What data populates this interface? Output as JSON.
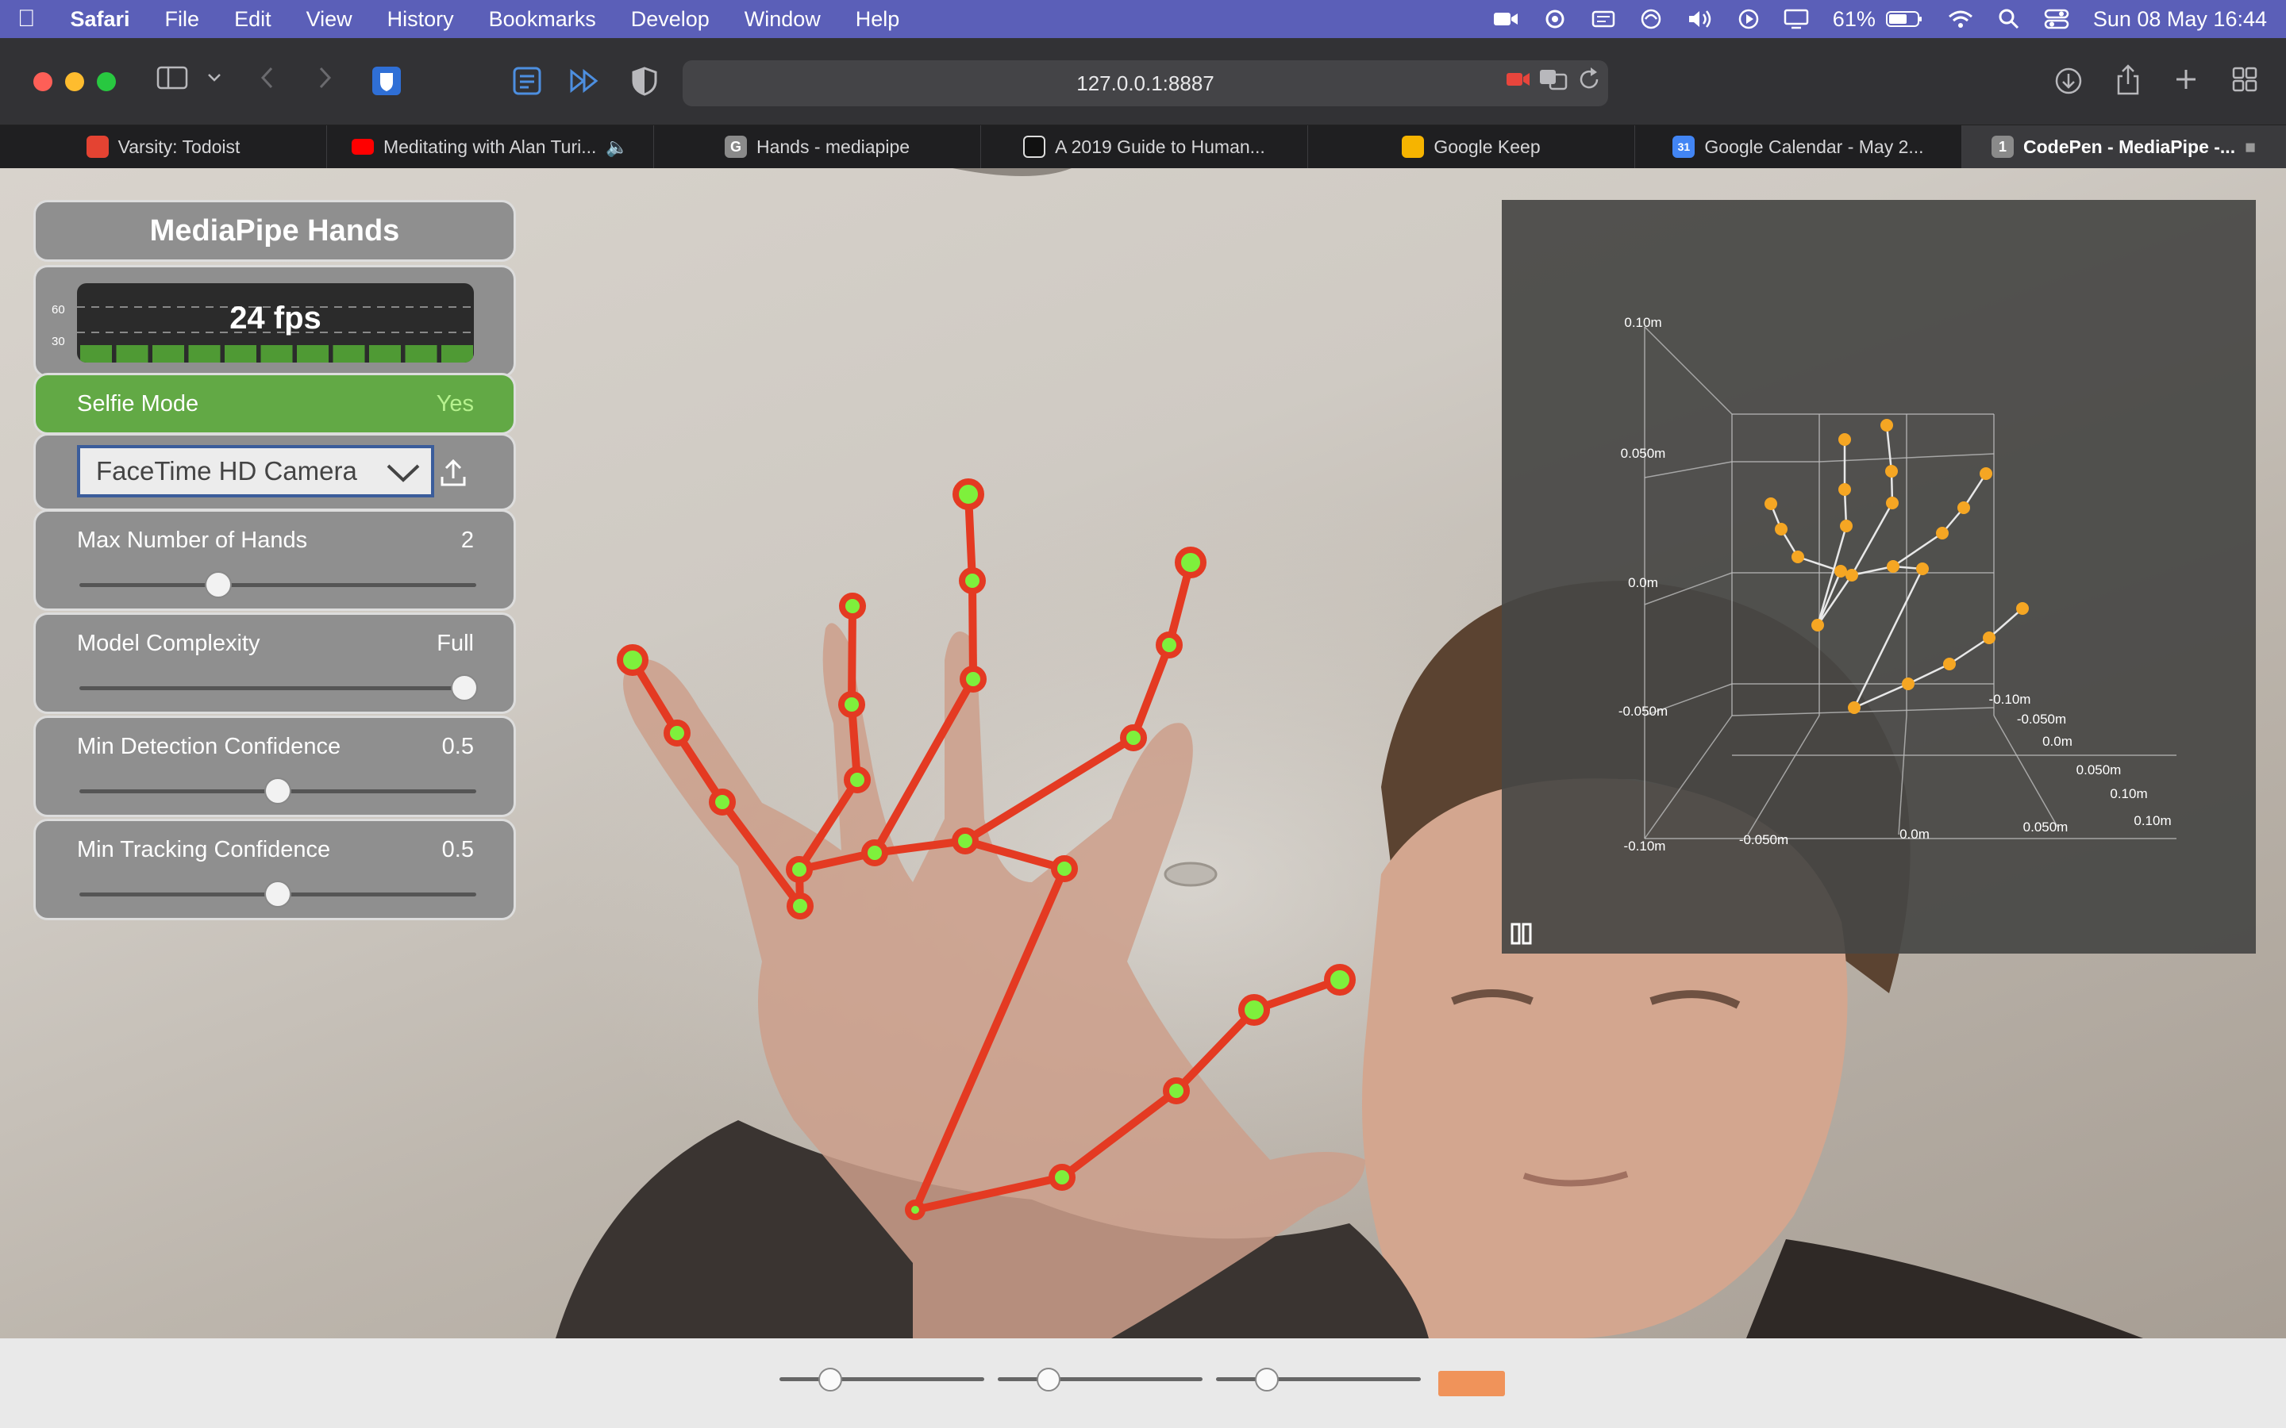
{
  "menubar": {
    "apple": "",
    "app": "Safari",
    "items": [
      "File",
      "Edit",
      "View",
      "History",
      "Bookmarks",
      "Develop",
      "Window",
      "Help"
    ],
    "battery": "61%",
    "datetime": "Sun 08 May  16:44"
  },
  "toolbar": {
    "url": "127.0.0.1:8887"
  },
  "tabs": [
    {
      "label": "Varsity: Todoist",
      "icon": "todoist-icon",
      "color": "#e44332",
      "glyph": ""
    },
    {
      "label": "Meditating with Alan Turi...",
      "icon": "youtube-icon",
      "color": "#ff0000",
      "glyph": ""
    },
    {
      "label": "Hands - mediapipe",
      "icon": "google-icon",
      "color": "#8a8a8a",
      "glyph": "G"
    },
    {
      "label": "A 2019 Guide to Human...",
      "icon": "medium-icon",
      "color": "#111111",
      "glyph": ""
    },
    {
      "label": "Google Keep",
      "icon": "keep-icon",
      "color": "#f6b400",
      "glyph": ""
    },
    {
      "label": "Google Calendar - May 2...",
      "icon": "calendar-icon",
      "color": "#4285f4",
      "glyph": "31"
    },
    {
      "label": "CodePen - MediaPipe -...",
      "icon": "codepen-icon",
      "color": "#8a8a8a",
      "glyph": "1"
    }
  ],
  "panel": {
    "title": "MediaPipe Hands",
    "fps": {
      "value": "24 fps",
      "axis_hi": "60",
      "axis_lo": "30",
      "bars": 11
    },
    "selfie": {
      "label": "Selfie Mode",
      "value": "Yes"
    },
    "camera": {
      "value": "FaceTime HD Camera"
    },
    "max_hands": {
      "label": "Max Number of Hands",
      "value": "2",
      "fraction": 0.35
    },
    "complexity": {
      "label": "Model Complexity",
      "value": "Full",
      "fraction": 0.97
    },
    "min_detection": {
      "label": "Min Detection Confidence",
      "value": "0.5",
      "fraction": 0.5
    },
    "min_tracking": {
      "label": "Min Tracking Confidence",
      "value": "0.5",
      "fraction": 0.5
    }
  },
  "plot3d": {
    "axis_labels": {
      "y": [
        "0.10m",
        "0.050m",
        "0.0m",
        "-0.050m"
      ],
      "x": [
        "-0.10m",
        "-0.050m",
        "0.0m",
        "0.050m",
        "0.10m"
      ],
      "z": [
        "-0.10m",
        "-0.050m",
        "0.0m",
        "0.050m",
        "0.10m"
      ]
    }
  },
  "bottom": {
    "slider_fractions": [
      0.24,
      0.24,
      0.24
    ],
    "button_color": "#f0935a"
  },
  "colors": {
    "landmark": "#7ef03c",
    "connector": "#e43a22",
    "plot_point": "#f5a623",
    "selfie_green": "#6cbf4a"
  }
}
